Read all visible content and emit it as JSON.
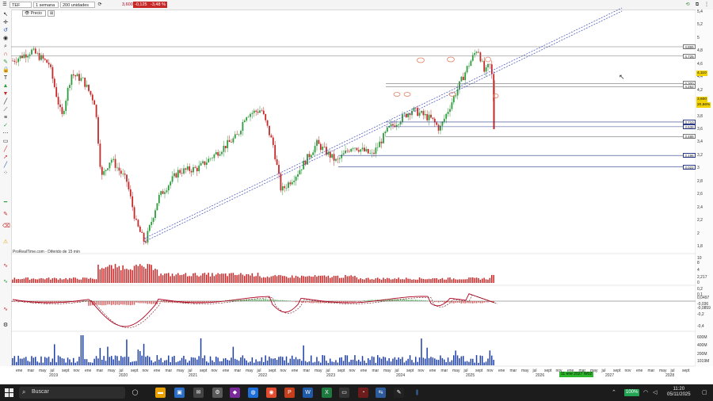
{
  "toolbar": {
    "symbol": "TEF",
    "period": "1 semana",
    "units": "200 unidades",
    "last_price": "3,600",
    "change_abs": "-0,125",
    "change_pct": "-3,48 %"
  },
  "chart_header": {
    "price_chip": "Precio"
  },
  "colors": {
    "up": "#2e9b3c",
    "down": "#c62828",
    "volume": "#1f3fa8",
    "macd": "#b00020",
    "accent_green": "#2bb52b"
  },
  "price_axis": [
    "5,4",
    "5,2",
    "5",
    "4,8",
    "4,6",
    "4,4",
    "4,2",
    "4",
    "3,8",
    "3,6",
    "3,4",
    "3,2",
    "3",
    "2,8",
    "2,6",
    "2,4",
    "2,2",
    "2",
    "1,8"
  ],
  "price_badges": {
    "current": "4,110",
    "last": "3,600",
    "pct": "20,86%"
  },
  "levels": [
    {
      "label": "4,865",
      "value": 4.865,
      "color": "#777777"
    },
    {
      "label": "4,725",
      "value": 4.725,
      "color": "#777777"
    },
    {
      "label": "4,300",
      "value": 4.3,
      "color": "#777777"
    },
    {
      "label": "4,252",
      "value": 4.252,
      "color": "#777777"
    },
    {
      "label": "3,710",
      "value": 3.71,
      "color": "#2b3a8a"
    },
    {
      "label": "3,638",
      "value": 3.638,
      "color": "#2b3a8a"
    },
    {
      "label": "3,485",
      "value": 3.485,
      "color": "#777777"
    },
    {
      "label": "3,196",
      "value": 3.196,
      "color": "#2b3a8a"
    },
    {
      "label": "3,022",
      "value": 3.022,
      "color": "#2b3a8a"
    }
  ],
  "volume_pane": {
    "label": "ProRealTime.com - Diferido de 15 min",
    "axis": [
      "10",
      "8",
      "4",
      "2,217",
      "0"
    ]
  },
  "macd_pane": {
    "axis": [
      "0,2",
      "0,1",
      "0,0497",
      "-0,036",
      "-0,0859",
      "-0,2",
      "-0,4"
    ]
  },
  "vol2_pane": {
    "axis": [
      "600M",
      "400M",
      "200M",
      "1019M"
    ]
  },
  "x_axis": {
    "months": [
      "ene",
      "mar",
      "may",
      "jul",
      "sept",
      "nov",
      "ene",
      "mar",
      "may",
      "jul",
      "sept",
      "nov",
      "ene",
      "mar",
      "may",
      "jul",
      "sept",
      "nov",
      "ene",
      "mar",
      "may",
      "jul",
      "sept",
      "nov",
      "ene",
      "mar",
      "may",
      "jul",
      "sept",
      "nov",
      "ene",
      "mar",
      "may",
      "jul",
      "sept",
      "nov",
      "ene",
      "mar",
      "may",
      "jul",
      "sept",
      "nov",
      "ene",
      "mar",
      "may",
      "jul",
      "sept",
      "nov",
      "ene",
      "mar",
      "may",
      "jul",
      "sept",
      "nov",
      "ene",
      "mar",
      "may",
      "jul",
      "sept"
    ],
    "years": [
      "2019",
      "2020",
      "2021",
      "2022",
      "2023",
      "2024",
      "2025",
      "2026",
      "2027",
      "2028"
    ],
    "cursor_label": "11 ene 2027 W02"
  },
  "taskbar": {
    "search_placeholder": "Buscar",
    "battery": "100%",
    "time": "11:20",
    "date": "05/11/2025"
  }
}
